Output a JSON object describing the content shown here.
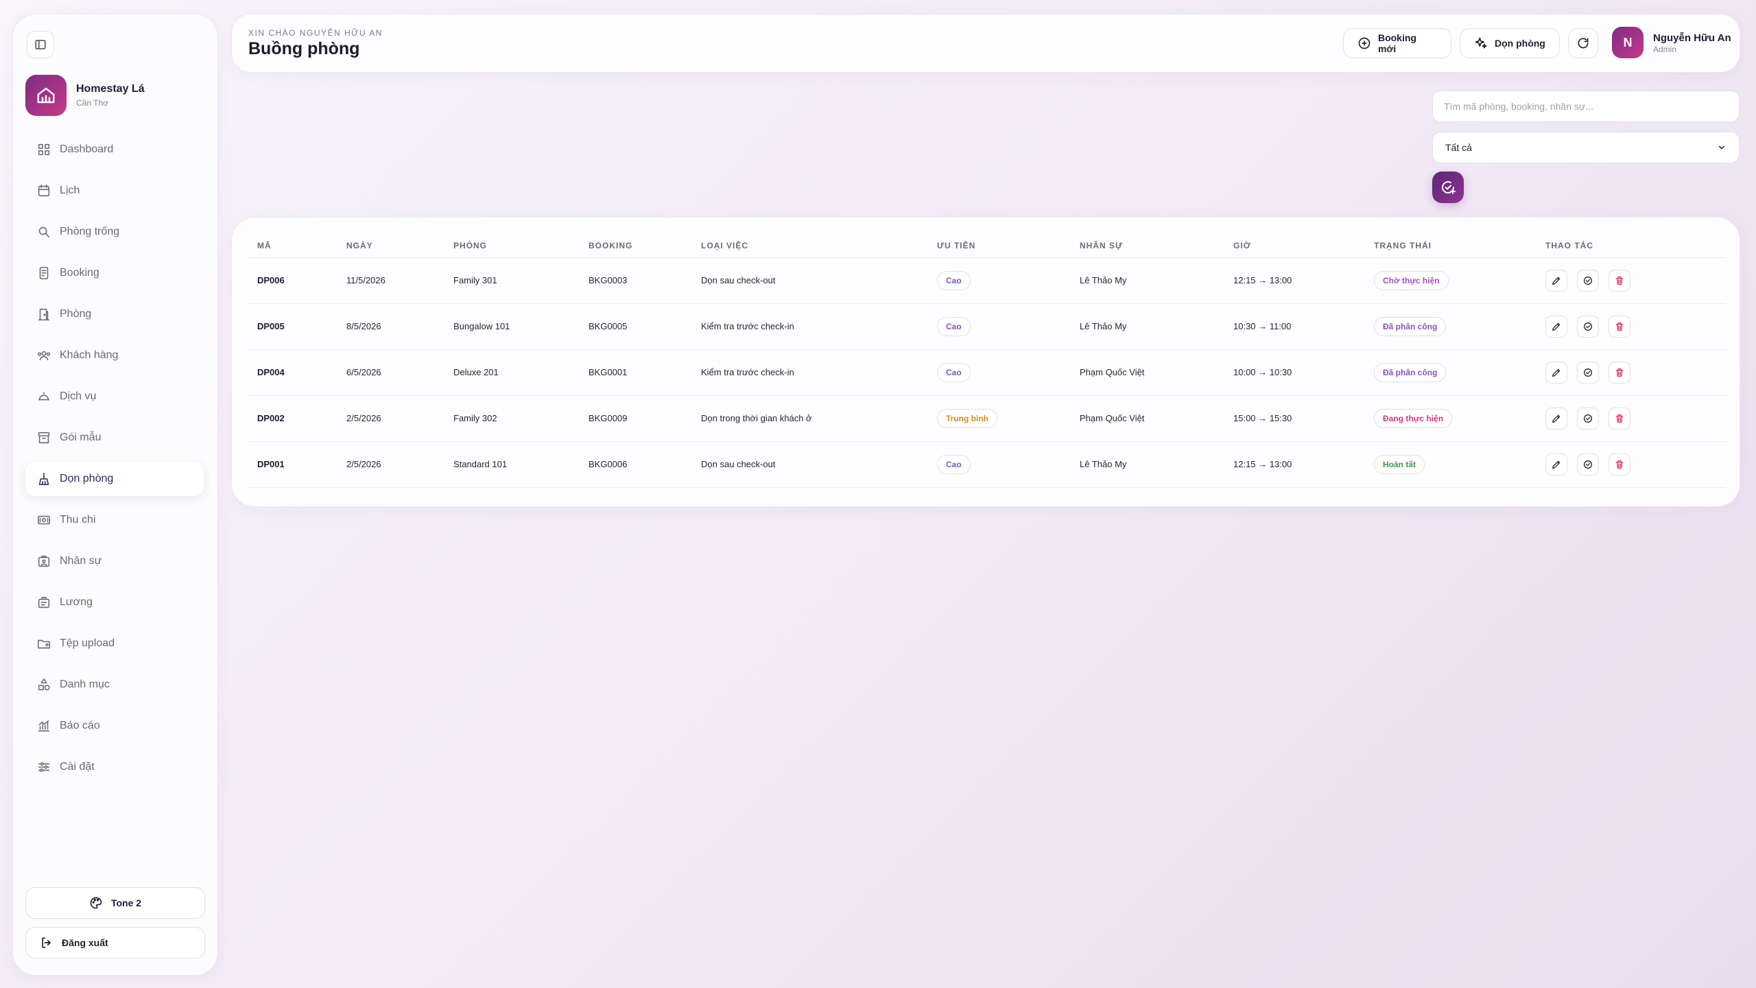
{
  "brand": {
    "name": "Homestay Lá",
    "location": "Cần Thơ"
  },
  "nav": [
    {
      "label": "Dashboard",
      "icon": "grid-icon"
    },
    {
      "label": "Lịch",
      "icon": "calendar-icon"
    },
    {
      "label": "Phòng trống",
      "icon": "search-icon"
    },
    {
      "label": "Booking",
      "icon": "booking-icon"
    },
    {
      "label": "Phòng",
      "icon": "door-icon"
    },
    {
      "label": "Khách hàng",
      "icon": "users-icon"
    },
    {
      "label": "Dịch vụ",
      "icon": "cloche-icon"
    },
    {
      "label": "Gói mẫu",
      "icon": "archive-icon"
    },
    {
      "label": "Dọn phòng",
      "icon": "broom-icon",
      "active": true
    },
    {
      "label": "Thu chi",
      "icon": "money-icon"
    },
    {
      "label": "Nhân sự",
      "icon": "id-card-icon"
    },
    {
      "label": "Lương",
      "icon": "payroll-icon"
    },
    {
      "label": "Tệp upload",
      "icon": "folder-icon"
    },
    {
      "label": "Danh mục",
      "icon": "shapes-icon"
    },
    {
      "label": "Báo cáo",
      "icon": "chart-icon"
    },
    {
      "label": "Cài đặt",
      "icon": "sliders-icon"
    }
  ],
  "sidebar_footer": {
    "tone_label": "Tone 2",
    "logout_label": "Đăng xuất"
  },
  "header": {
    "greeting": "XIN CHÀO NGUYỄN HỮU AN",
    "title": "Buồng phòng",
    "booking_button": "Booking mới",
    "clean_button": "Dọn phòng",
    "user": {
      "initial": "N",
      "name": "Nguyễn Hữu An",
      "role": "Admin"
    }
  },
  "toolbar": {
    "search_placeholder": "Tìm mã phòng, booking, nhân sự...",
    "search_value": "",
    "filter_selected": "Tất cả"
  },
  "table": {
    "columns": [
      "MÃ",
      "NGÀY",
      "PHÒNG",
      "BOOKING",
      "LOẠI VIỆC",
      "ƯU TIÊN",
      "NHÂN SỰ",
      "GIỜ",
      "TRẠNG THÁI",
      "THAO TÁC"
    ],
    "rows": [
      {
        "code": "DP006",
        "date": "11/5/2026",
        "room": "Family 301",
        "booking": "BKG0003",
        "task": "Dọn sau check-out",
        "priority": "Cao",
        "priority_level": "high",
        "staff": "Lê Thảo My",
        "time": "12:15 → 13:00",
        "status": "Chờ thực hiện",
        "status_key": "wait"
      },
      {
        "code": "DP005",
        "date": "8/5/2026",
        "room": "Bungalow 101",
        "booking": "BKG0005",
        "task": "Kiểm tra trước check-in",
        "priority": "Cao",
        "priority_level": "high",
        "staff": "Lê Thảo My",
        "time": "10:30 → 11:00",
        "status": "Đã phân công",
        "status_key": "assigned"
      },
      {
        "code": "DP004",
        "date": "6/5/2026",
        "room": "Deluxe 201",
        "booking": "BKG0001",
        "task": "Kiểm tra trước check-in",
        "priority": "Cao",
        "priority_level": "high",
        "staff": "Phạm Quốc Việt",
        "time": "10:00 → 10:30",
        "status": "Đã phân công",
        "status_key": "assigned"
      },
      {
        "code": "DP002",
        "date": "2/5/2026",
        "room": "Family 302",
        "booking": "BKG0009",
        "task": "Dọn trong thời gian khách ở",
        "priority": "Trung bình",
        "priority_level": "mid",
        "staff": "Phạm Quốc Việt",
        "time": "15:00 → 15:30",
        "status": "Đang thực hiện",
        "status_key": "progress"
      },
      {
        "code": "DP001",
        "date": "2/5/2026",
        "room": "Standard 101",
        "booking": "BKG0006",
        "task": "Dọn sau check-out",
        "priority": "Cao",
        "priority_level": "high",
        "staff": "Lê Thảo My",
        "time": "12:15 → 13:00",
        "status": "Hoàn tất",
        "status_key": "done"
      }
    ]
  }
}
